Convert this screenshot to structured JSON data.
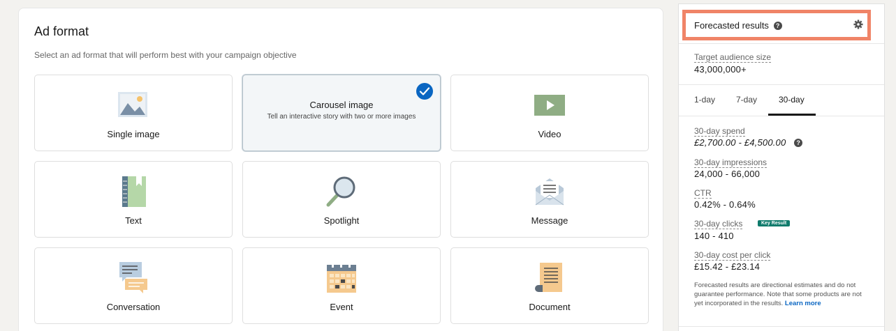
{
  "ad_format": {
    "title": "Ad format",
    "subtitle": "Select an ad format that will perform best with your campaign objective",
    "cards": [
      {
        "label": "Single image",
        "icon": "image-icon"
      },
      {
        "label": "Carousel image",
        "description": "Tell an interactive story with two or more images",
        "icon": "checkmark-icon",
        "selected": true
      },
      {
        "label": "Video",
        "icon": "video-play-icon"
      },
      {
        "label": "Text",
        "icon": "notebook-icon"
      },
      {
        "label": "Spotlight",
        "icon": "magnifier-icon"
      },
      {
        "label": "Message",
        "icon": "envelope-icon"
      },
      {
        "label": "Conversation",
        "icon": "chat-bubbles-icon"
      },
      {
        "label": "Event",
        "icon": "calendar-icon"
      },
      {
        "label": "Document",
        "icon": "document-icon"
      }
    ]
  },
  "forecast": {
    "title": "Forecasted results",
    "audience_label": "Target audience size",
    "audience_value": "43,000,000+",
    "tabs": [
      "1-day",
      "7-day",
      "30-day"
    ],
    "active_tab": "30-day",
    "spend_label": "30-day spend",
    "spend_value": "£2,700.00 - £4,500.00",
    "impressions_label": "30-day impressions",
    "impressions_value": "24,000 - 66,000",
    "ctr_label": "CTR",
    "ctr_value": "0.42% - 0.64%",
    "clicks_label": "30-day clicks",
    "clicks_badge": "Key Result",
    "clicks_value": "140 - 410",
    "cpc_label": "30-day cost per click",
    "cpc_value": "£15.42 - £23.14",
    "disclaimer": "Forecasted results are directional estimates and do not guarantee performance. Note that some products are not yet incorporated in the results.",
    "learn_more": "Learn more"
  },
  "colors": {
    "accent": "#0a66c2",
    "highlight_border": "#f08467",
    "badge": "#0f7b6c"
  }
}
